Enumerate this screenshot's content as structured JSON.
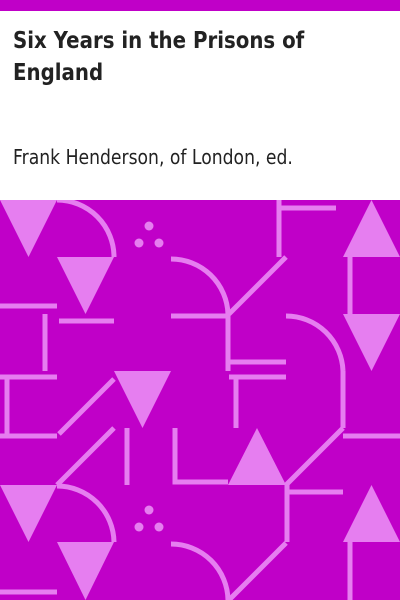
{
  "book": {
    "title": "Six Years in the Prisons of\nEngland",
    "author": "Frank Henderson, of London, ed."
  },
  "colors": {
    "band": "#c000c8",
    "pattern_background": "#c000c8",
    "pattern_shapes": "#e67ef0",
    "text": "#222222"
  }
}
